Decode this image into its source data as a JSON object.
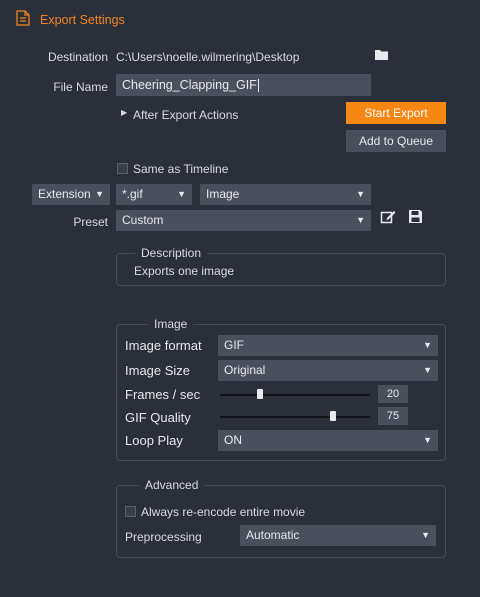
{
  "header": {
    "title": "Export Settings"
  },
  "destination": {
    "label": "Destination",
    "path": "C:\\Users\\noelle.wilmering\\Desktop"
  },
  "file_name": {
    "label": "File Name",
    "value": "Cheering_Clapping_GIF"
  },
  "after_export": {
    "label": "After Export Actions"
  },
  "buttons": {
    "start_export": "Start Export",
    "add_to_queue": "Add to Queue"
  },
  "same_as_timeline": {
    "label": "Same as Timeline",
    "checked": false
  },
  "format_row": {
    "type": "Extension",
    "extension": "*.gif",
    "kind": "Image"
  },
  "preset": {
    "label": "Preset",
    "value": "Custom"
  },
  "description": {
    "legend": "Description",
    "text": "Exports one image"
  },
  "image": {
    "legend": "Image",
    "format_label": "Image format",
    "format_value": "GIF",
    "size_label": "Image Size",
    "size_value": "Original",
    "fps_label": "Frames / sec",
    "fps_value": "20",
    "quality_label": "GIF Quality",
    "quality_value": "75",
    "loop_label": "Loop Play",
    "loop_value": "ON"
  },
  "advanced": {
    "legend": "Advanced",
    "reencode_label": "Always re-encode entire movie",
    "reencode_checked": false,
    "preprocessing_label": "Preprocessing",
    "preprocessing_value": "Automatic"
  },
  "colors": {
    "accent": "#f68712",
    "background": "#2b2f3a",
    "field": "#4a4f5c"
  }
}
